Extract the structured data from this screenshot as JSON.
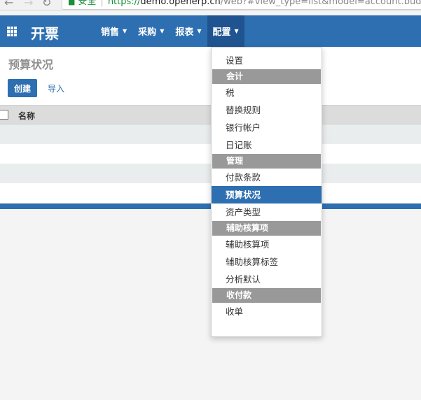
{
  "browser": {
    "secure_label": "安全",
    "url_scheme": "https://",
    "url_host": "demo.openerp.cn",
    "url_path": "/web?#view_type=list&model=account.budg"
  },
  "navbar": {
    "app_title": "开票",
    "menu": [
      {
        "label": "销售"
      },
      {
        "label": "采购"
      },
      {
        "label": "报表"
      },
      {
        "label": "配置"
      }
    ]
  },
  "control_panel": {
    "title": "预算状况",
    "create_label": "创建",
    "import_label": "导入"
  },
  "list": {
    "columns": [
      "名称"
    ]
  },
  "dropdown": {
    "items": [
      {
        "type": "item",
        "label": "设置"
      },
      {
        "type": "header",
        "label": "会计"
      },
      {
        "type": "item",
        "label": "税"
      },
      {
        "type": "item",
        "label": "替换规则"
      },
      {
        "type": "item",
        "label": "银行帐户"
      },
      {
        "type": "item",
        "label": "日记账"
      },
      {
        "type": "header",
        "label": "管理"
      },
      {
        "type": "item",
        "label": "付款条款"
      },
      {
        "type": "item",
        "label": "预算状况",
        "active": true
      },
      {
        "type": "item",
        "label": "资产类型"
      },
      {
        "type": "header",
        "label": "辅助核算项"
      },
      {
        "type": "item",
        "label": "辅助核算项"
      },
      {
        "type": "item",
        "label": "辅助核算标签"
      },
      {
        "type": "item",
        "label": "分析默认"
      },
      {
        "type": "header",
        "label": "收付款"
      },
      {
        "type": "item",
        "label": "收单"
      }
    ]
  },
  "colors": {
    "brand": "#2e6fb1",
    "active_menu": "#1f5490",
    "section_header": "#999999"
  },
  "icons": {
    "apps": "apps-grid-icon",
    "caret": "caret-down-icon"
  }
}
